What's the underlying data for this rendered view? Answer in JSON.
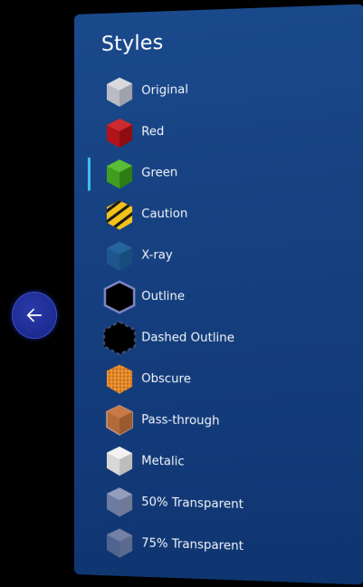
{
  "panel": {
    "title": "Styles",
    "selected_index": 2,
    "items": [
      {
        "label": "Original",
        "icon": "gray-cube-icon"
      },
      {
        "label": "Red",
        "icon": "red-cube-icon"
      },
      {
        "label": "Green",
        "icon": "green-cube-icon"
      },
      {
        "label": "Caution",
        "icon": "caution-stripe-cube-icon"
      },
      {
        "label": "X-ray",
        "icon": "xray-cube-icon"
      },
      {
        "label": "Outline",
        "icon": "outline-hexagon-icon"
      },
      {
        "label": "Dashed Outline",
        "icon": "dashed-outline-icon"
      },
      {
        "label": "Obscure",
        "icon": "obscure-cube-icon"
      },
      {
        "label": "Pass-through",
        "icon": "pass-through-cube-icon"
      },
      {
        "label": "Metalic",
        "icon": "metallic-cube-icon"
      },
      {
        "label": "50% Transparent",
        "icon": "transparent-50-cube-icon"
      },
      {
        "label": "75% Transparent",
        "icon": "transparent-75-cube-icon"
      }
    ]
  },
  "nav": {
    "back_icon": "arrow-left-icon"
  },
  "colors": {
    "panel_bg": "#164080",
    "accent": "#3fc0f0",
    "back_button": "#1d2b93"
  }
}
